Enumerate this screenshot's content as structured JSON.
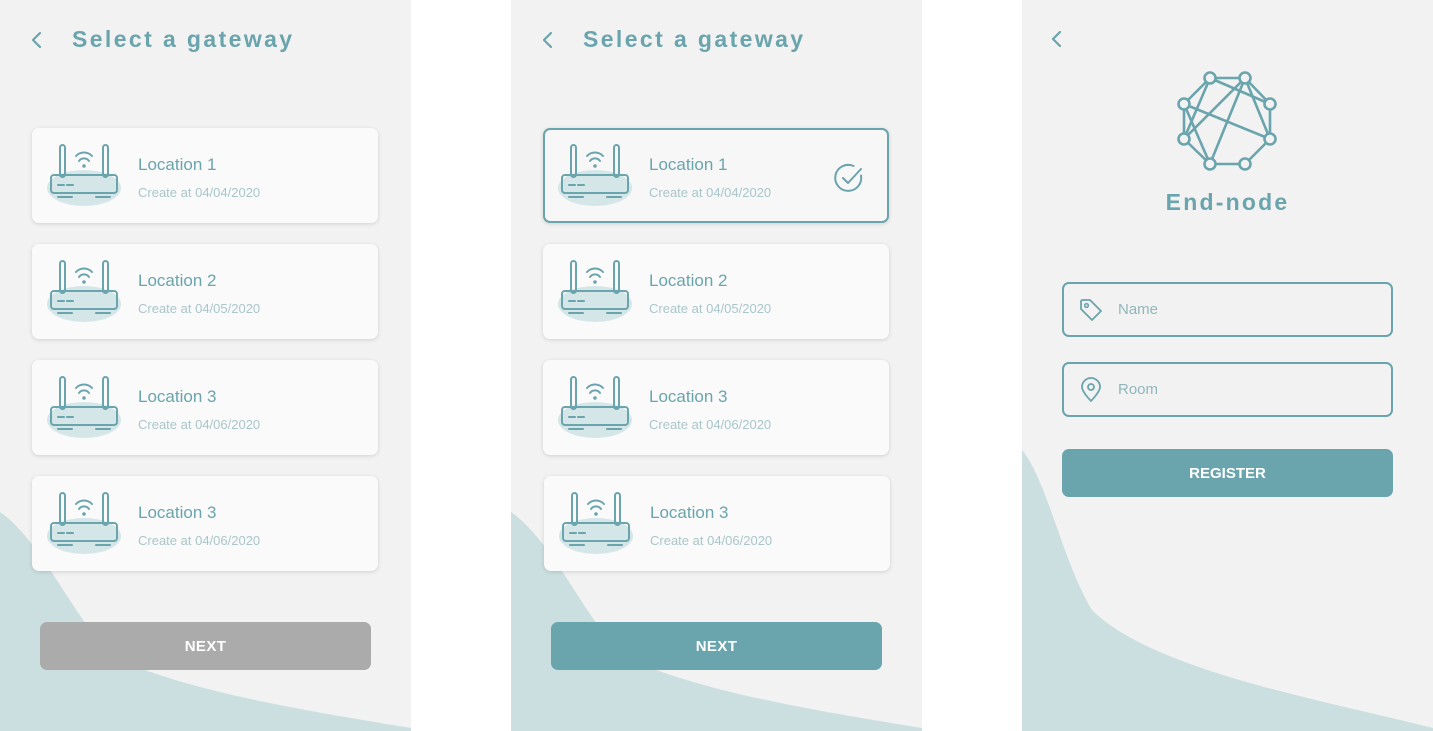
{
  "colors": {
    "accent": "#6aa4ad",
    "panel": "#f2f2f2",
    "wave": "#ccdfe0",
    "disabled": "#ababab"
  },
  "screen1": {
    "title": "Select a gateway",
    "items": [
      {
        "label": "Location 1",
        "date": "Create at 04/04/2020"
      },
      {
        "label": "Location 2",
        "date": "Create at 04/05/2020"
      },
      {
        "label": "Location 3",
        "date": "Create at 04/06/2020"
      },
      {
        "label": "Location 3",
        "date": "Create at 04/06/2020"
      }
    ],
    "next_label": "NEXT",
    "next_state": "disabled"
  },
  "screen2": {
    "title": "Select a gateway",
    "items": [
      {
        "label": "Location 1",
        "date": "Create at 04/04/2020",
        "selected": true
      },
      {
        "label": "Location 2",
        "date": "Create at 04/05/2020"
      },
      {
        "label": "Location 3",
        "date": "Create at 04/06/2020"
      },
      {
        "label": "Location 3",
        "date": "Create at 04/06/2020"
      }
    ],
    "next_label": "NEXT",
    "next_state": "enabled"
  },
  "screen3": {
    "brand": "End-node",
    "name_placeholder": "Name",
    "room_placeholder": "Room",
    "register_label": "REGISTER"
  },
  "icons": [
    "chevron-left-icon",
    "router-icon",
    "check-circle-icon",
    "network-logo-icon",
    "tag-icon",
    "location-pin-icon"
  ]
}
